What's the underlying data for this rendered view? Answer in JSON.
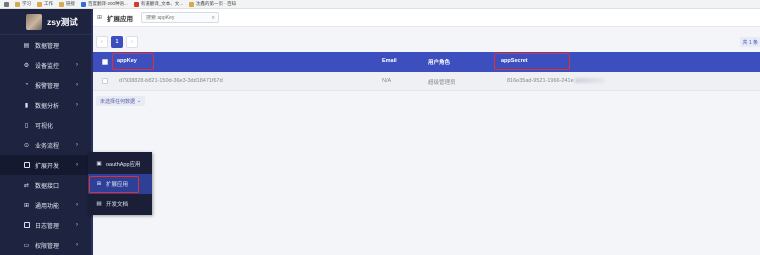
{
  "bookmarks": [
    {
      "label": "",
      "icon": "apps-grid-icon"
    },
    {
      "label": "学习",
      "icon": "folder-icon"
    },
    {
      "label": "工作",
      "icon": "folder-icon"
    },
    {
      "label": "链接",
      "icon": "folder-icon"
    },
    {
      "label": "百度翻译-200种语...",
      "icon": "baidu-icon"
    },
    {
      "label": "有道翻译_文本、文...",
      "icon": "youdao-icon"
    },
    {
      "label": "沈鑫的第一页 · 百知",
      "icon": "page-icon"
    }
  ],
  "brand": {
    "name": "zsy测试"
  },
  "menu": [
    {
      "label": "数据管理",
      "icon": "database-icon",
      "arrow": false
    },
    {
      "label": "设备监控",
      "icon": "monitor-icon",
      "arrow": true
    },
    {
      "label": "报警管理",
      "icon": "alarm-icon",
      "arrow": true
    },
    {
      "label": "数据分析",
      "icon": "bar-chart-icon",
      "arrow": true
    },
    {
      "label": "可视化",
      "icon": "screen-icon",
      "arrow": false
    },
    {
      "label": "业务流程",
      "icon": "flow-icon",
      "arrow": true
    },
    {
      "label": "扩展开发",
      "icon": "extension-icon",
      "arrow": true
    },
    {
      "label": "数据接口",
      "icon": "api-icon",
      "arrow": false
    },
    {
      "label": "通用功能",
      "icon": "grid-icon",
      "arrow": true
    },
    {
      "label": "日志管理",
      "icon": "log-icon",
      "arrow": true
    },
    {
      "label": "权限管理",
      "icon": "lock-icon",
      "arrow": true
    }
  ],
  "flyout": [
    {
      "label": "oauthApp应用",
      "icon": "app-window-icon"
    },
    {
      "label": "扩展应用",
      "icon": "apps-icon"
    },
    {
      "label": "开发文档",
      "icon": "doc-icon"
    }
  ],
  "topbar": {
    "title": "扩展应用",
    "search_placeholder": "搜索 appKey"
  },
  "pager": {
    "current": "1",
    "prev": "‹",
    "next": "›",
    "total": "共 1 条"
  },
  "table": {
    "columns": [
      "appKey",
      "Email",
      "用户角色",
      "appSecret"
    ],
    "rows": [
      {
        "appKey": "d7938828-b821-150d-36e3-3dd18471f67d",
        "email": "N/A",
        "role": "超级管理员",
        "appSecret": "816e35ad-9521-1966-241e"
      }
    ]
  },
  "select_button": {
    "label": "未选择任何数据",
    "icon": "chevron-down-icon"
  },
  "colors": {
    "sidebar": "#1e2340",
    "accent": "#3d4fbf",
    "highlight": "#e03131"
  }
}
